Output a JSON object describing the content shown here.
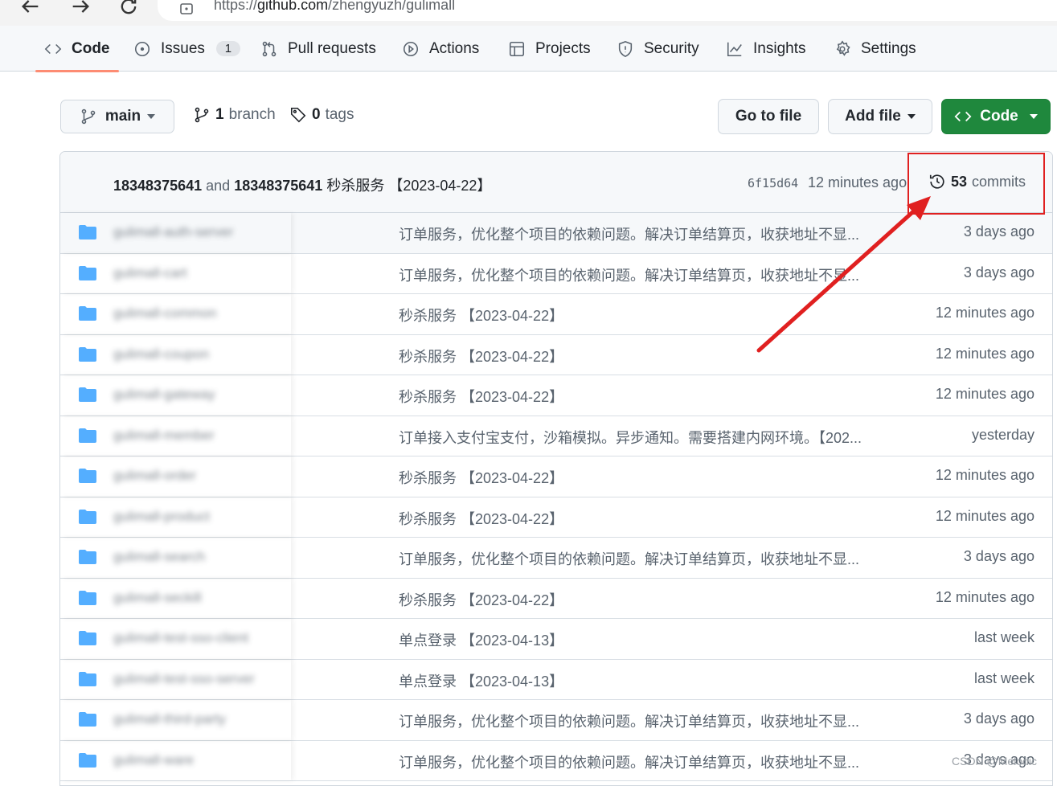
{
  "browser": {
    "url_prefix": "https://",
    "url_host": "github.com",
    "url_path": "/zhengyuzh/gulimall"
  },
  "tabs": [
    {
      "label": "Code",
      "icon": "code-icon",
      "selected": true
    },
    {
      "label": "Issues",
      "icon": "issue-icon",
      "counter": "1"
    },
    {
      "label": "Pull requests",
      "icon": "pull-request-icon"
    },
    {
      "label": "Actions",
      "icon": "play-icon"
    },
    {
      "label": "Projects",
      "icon": "table-icon"
    },
    {
      "label": "Security",
      "icon": "shield-icon"
    },
    {
      "label": "Insights",
      "icon": "graph-icon"
    },
    {
      "label": "Settings",
      "icon": "gear-icon"
    }
  ],
  "toolbar": {
    "branch_label": "main",
    "branch_count": "1",
    "branch_word": "branch",
    "tag_count": "0",
    "tag_word": "tags",
    "go_to_file": "Go to file",
    "add_file": "Add file",
    "code": "Code"
  },
  "latest_commit": {
    "author1": "18348375641",
    "and": "and",
    "author2": "18348375641",
    "message": "秒杀服务 【2023-04-22】",
    "sha": "6f15d64",
    "time": "12 minutes ago",
    "commit_count": "53",
    "commit_word": "commits"
  },
  "files": [
    {
      "name": "gulimall-auth-server",
      "message": "订单服务，优化整个项目的依赖问题。解决订单结算页，收获地址不显...",
      "age": "3 days ago"
    },
    {
      "name": "gulimall-cart",
      "message": "订单服务，优化整个项目的依赖问题。解决订单结算页，收获地址不显...",
      "age": "3 days ago"
    },
    {
      "name": "gulimall-common",
      "message": "秒杀服务 【2023-04-22】",
      "age": "12 minutes ago"
    },
    {
      "name": "gulimall-coupon",
      "message": "秒杀服务 【2023-04-22】",
      "age": "12 minutes ago"
    },
    {
      "name": "gulimall-gateway",
      "message": "秒杀服务 【2023-04-22】",
      "age": "12 minutes ago"
    },
    {
      "name": "gulimall-member",
      "message": "订单接入支付宝支付，沙箱模拟。异步通知。需要搭建内网环境。【202...",
      "age": "yesterday"
    },
    {
      "name": "gulimall-order",
      "message": "秒杀服务 【2023-04-22】",
      "age": "12 minutes ago"
    },
    {
      "name": "gulimall-product",
      "message": "秒杀服务 【2023-04-22】",
      "age": "12 minutes ago"
    },
    {
      "name": "gulimall-search",
      "message": "订单服务，优化整个项目的依赖问题。解决订单结算页，收获地址不显...",
      "age": "3 days ago"
    },
    {
      "name": "gulimall-seckill",
      "message": "秒杀服务 【2023-04-22】",
      "age": "12 minutes ago"
    },
    {
      "name": "gulimall-test-sso-client",
      "message": "单点登录 【2023-04-13】",
      "age": "last week"
    },
    {
      "name": "gulimall-test-sso-server",
      "message": "单点登录 【2023-04-13】",
      "age": "last week"
    },
    {
      "name": "gulimall-third-party",
      "message": "订单服务，优化整个项目的依赖问题。解决订单结算页，收获地址不显...",
      "age": "3 days ago"
    },
    {
      "name": "gulimall-ware",
      "message": "订单服务，优化整个项目的依赖问题。解决订单结算页，收获地址不显...",
      "age": "3 days ago"
    }
  ],
  "watermark": "CSDN @Melodic",
  "colors": {
    "accent_underline": "#fd8c73",
    "code_button": "#1f883d",
    "folder": "#54aeff",
    "annotation": "#e02020"
  }
}
